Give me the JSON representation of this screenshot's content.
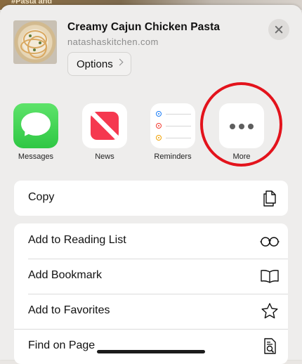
{
  "header": {
    "title": "Creamy Cajun Chicken Pasta",
    "domain": "natashaskitchen.com",
    "options_label": "Options",
    "background_tag": "#Pasta and"
  },
  "apps": [
    {
      "label": "Messages",
      "icon": "messages-icon"
    },
    {
      "label": "News",
      "icon": "news-icon"
    },
    {
      "label": "Reminders",
      "icon": "reminders-icon"
    },
    {
      "label": "More",
      "icon": "more-icon"
    }
  ],
  "actions": {
    "copy": {
      "label": "Copy",
      "icon": "copy-icon"
    },
    "list": [
      {
        "label": "Add to Reading List",
        "icon": "glasses-icon"
      },
      {
        "label": "Add Bookmark",
        "icon": "book-icon"
      },
      {
        "label": "Add to Favorites",
        "icon": "star-icon"
      },
      {
        "label": "Find on Page",
        "icon": "find-page-icon"
      }
    ]
  },
  "colors": {
    "messages_green": "#34c759",
    "news_red": "#f5384f",
    "highlight_red": "#e3131c",
    "reminder_blue": "#1a7cf5",
    "reminder_red": "#f23b30",
    "reminder_orange": "#f0a000"
  }
}
